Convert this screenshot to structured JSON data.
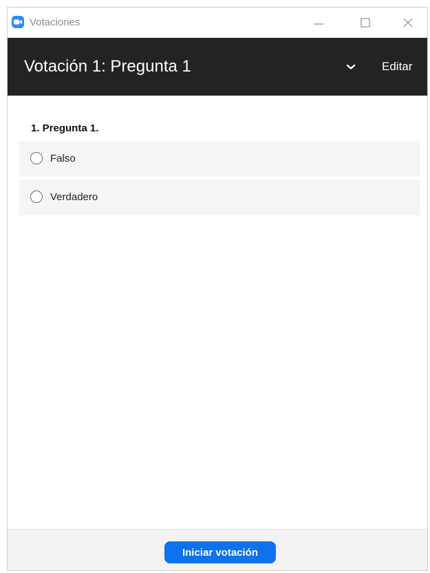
{
  "window": {
    "title": "Votaciones",
    "icon": "zoom-app-icon",
    "controls": [
      "minimize-icon",
      "maximize-icon",
      "close-icon"
    ]
  },
  "header": {
    "title": "Votación 1: Pregunta 1",
    "menu_icon": "chevron-down-icon",
    "edit_label": "Editar"
  },
  "question": {
    "title": "1. Pregunta 1.",
    "options": [
      {
        "label": "Falso",
        "selected": false
      },
      {
        "label": "Verdadero",
        "selected": false
      }
    ]
  },
  "footer": {
    "start_label": "Iniciar votación"
  },
  "colors": {
    "header_bg": "#232323",
    "primary": "#0e72ed",
    "app_icon": "#2d8cff",
    "option_bg": "#f5f5f5",
    "footer_bg": "#f2f2f2"
  }
}
